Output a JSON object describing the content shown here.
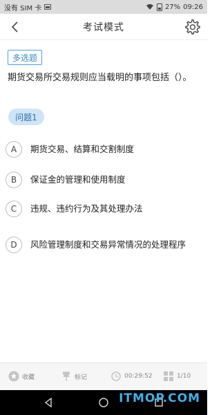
{
  "status_bar": {
    "carrier": "没有 SIM 卡",
    "battery": "27%",
    "time": "09:26"
  },
  "header": {
    "title": "考试模式"
  },
  "question": {
    "type_label": "多选题",
    "text": "期货交易所交易规则应当载明的事项包括（）。",
    "number_label": "问题1",
    "options": [
      {
        "letter": "A",
        "text": "期货交易、结算和交割制度"
      },
      {
        "letter": "B",
        "text": "保证金的管理和使用制度"
      },
      {
        "letter": "C",
        "text": "违规、违约行为及其处理办法"
      },
      {
        "letter": "D",
        "text": "风险管理制度和交易异常情况的处理程序"
      }
    ]
  },
  "bottom_bar": {
    "favorite": "收藏",
    "mark": "标记",
    "timer": "00:29:52",
    "progress": "1/10"
  },
  "watermark": "ITMOP.COM",
  "colors": {
    "accent_blue": "#4aa3df",
    "tag_bg": "#cfe4f6",
    "bottom_bg": "#f6f6f6"
  }
}
